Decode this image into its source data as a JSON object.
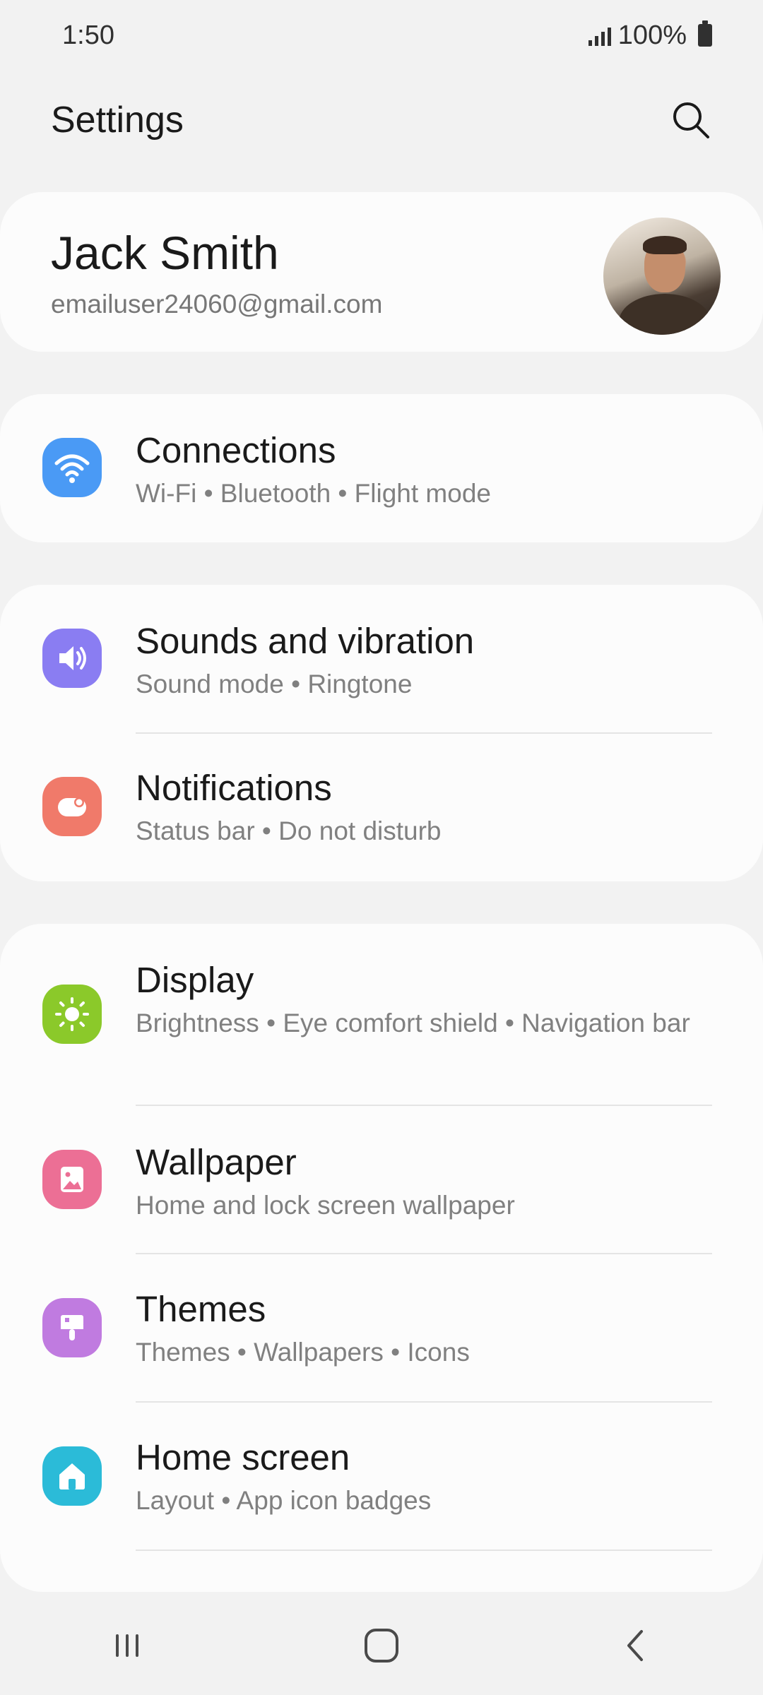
{
  "status_bar": {
    "time": "1:50",
    "battery": "100%"
  },
  "header": {
    "title": "Settings"
  },
  "profile": {
    "name": "Jack Smith",
    "email": "emailuser24060@gmail.com"
  },
  "groups": [
    {
      "items": [
        {
          "title": "Connections",
          "subtitle": "Wi-Fi  •  Bluetooth  •  Flight mode",
          "icon": "wifi-icon",
          "color": "#4a9af5"
        }
      ]
    },
    {
      "items": [
        {
          "title": "Sounds and vibration",
          "subtitle": "Sound mode  •  Ringtone",
          "icon": "speaker-icon",
          "color": "#8a7df2"
        },
        {
          "title": "Notifications",
          "subtitle": "Status bar  •  Do not disturb",
          "icon": "notification-icon",
          "color": "#f07a6a"
        }
      ]
    },
    {
      "items": [
        {
          "title": "Display",
          "subtitle": "Brightness  •  Eye comfort shield  •  Navigation bar",
          "icon": "sun-icon",
          "color": "#8bc92a"
        },
        {
          "title": "Wallpaper",
          "subtitle": "Home and lock screen wallpaper",
          "icon": "image-icon",
          "color": "#ec6f95"
        },
        {
          "title": "Themes",
          "subtitle": "Themes  •  Wallpapers  •  Icons",
          "icon": "brush-icon",
          "color": "#c07be0"
        },
        {
          "title": "Home screen",
          "subtitle": "Layout  •  App icon badges",
          "icon": "home-icon",
          "color": "#2bbbd8"
        }
      ]
    }
  ],
  "nav": {
    "recents": "recents-icon",
    "home": "home-button-icon",
    "back": "back-icon"
  }
}
